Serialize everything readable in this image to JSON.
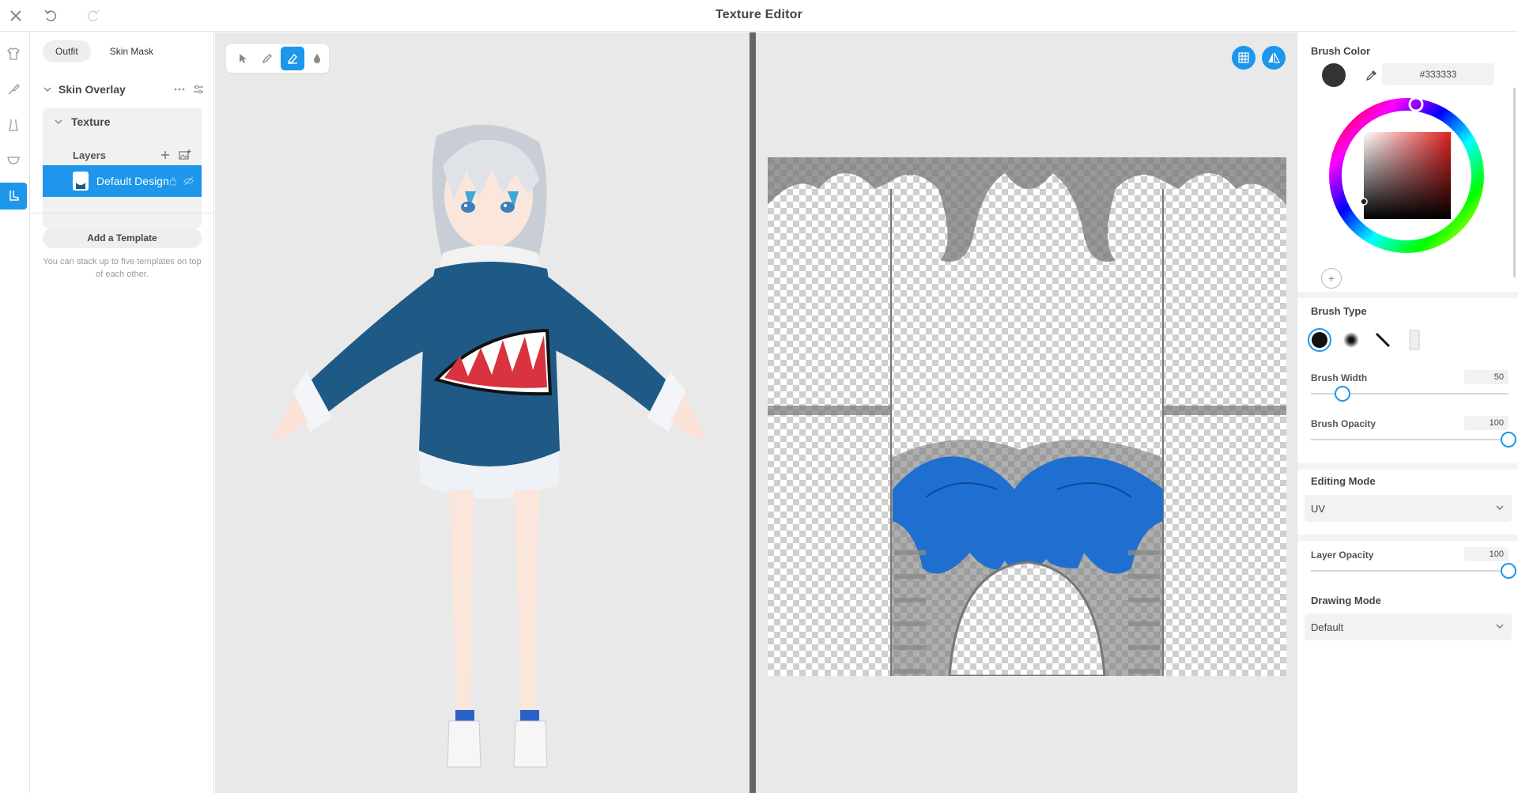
{
  "window": {
    "title": "Texture Editor"
  },
  "toolbar": {
    "close_icon": "close-icon",
    "undo_icon": "undo-icon",
    "redo_icon": "redo-icon"
  },
  "rail": [
    {
      "icon": "outfit-shirt-icon"
    },
    {
      "icon": "brush-icon"
    },
    {
      "icon": "dress-icon"
    },
    {
      "icon": "accessory-icon"
    },
    {
      "icon": "texture-boot-icon",
      "active": true
    }
  ],
  "layers_panel": {
    "tabs": [
      {
        "label": "Outfit",
        "active": true
      },
      {
        "label": "Skin Mask",
        "active": false
      }
    ],
    "group": {
      "label": "Skin Overlay"
    },
    "texture": {
      "label": "Texture"
    },
    "layers": {
      "label": "Layers"
    },
    "selected_layer": {
      "name": "Default Design"
    },
    "add_template_label": "Add a Template",
    "hint": "You can stack up to five templates on top of each other."
  },
  "tools": [
    {
      "icon": "select-arrow-icon",
      "active": false
    },
    {
      "icon": "pen-icon",
      "active": false
    },
    {
      "icon": "eraser-icon",
      "active": true
    },
    {
      "icon": "fill-drop-icon",
      "active": false
    }
  ],
  "properties": {
    "brush_color": {
      "title": "Brush Color",
      "hex": "#333333"
    },
    "brush_type": {
      "title": "Brush Type"
    },
    "brush_width": {
      "label": "Brush Width",
      "value": "50",
      "fraction": 0.16
    },
    "brush_opacity": {
      "label": "Brush Opacity",
      "value": "100",
      "fraction": 1.0
    },
    "editing_mode": {
      "title": "Editing Mode",
      "value": "UV"
    },
    "layer_opacity": {
      "label": "Layer Opacity",
      "value": "100",
      "fraction": 1.0
    },
    "drawing_mode": {
      "title": "Drawing Mode",
      "value": "Default"
    }
  },
  "colors": {
    "accent": "#1d96ec",
    "hoodie": "#1f5a86",
    "uv_blue": "#1e6fd0"
  }
}
